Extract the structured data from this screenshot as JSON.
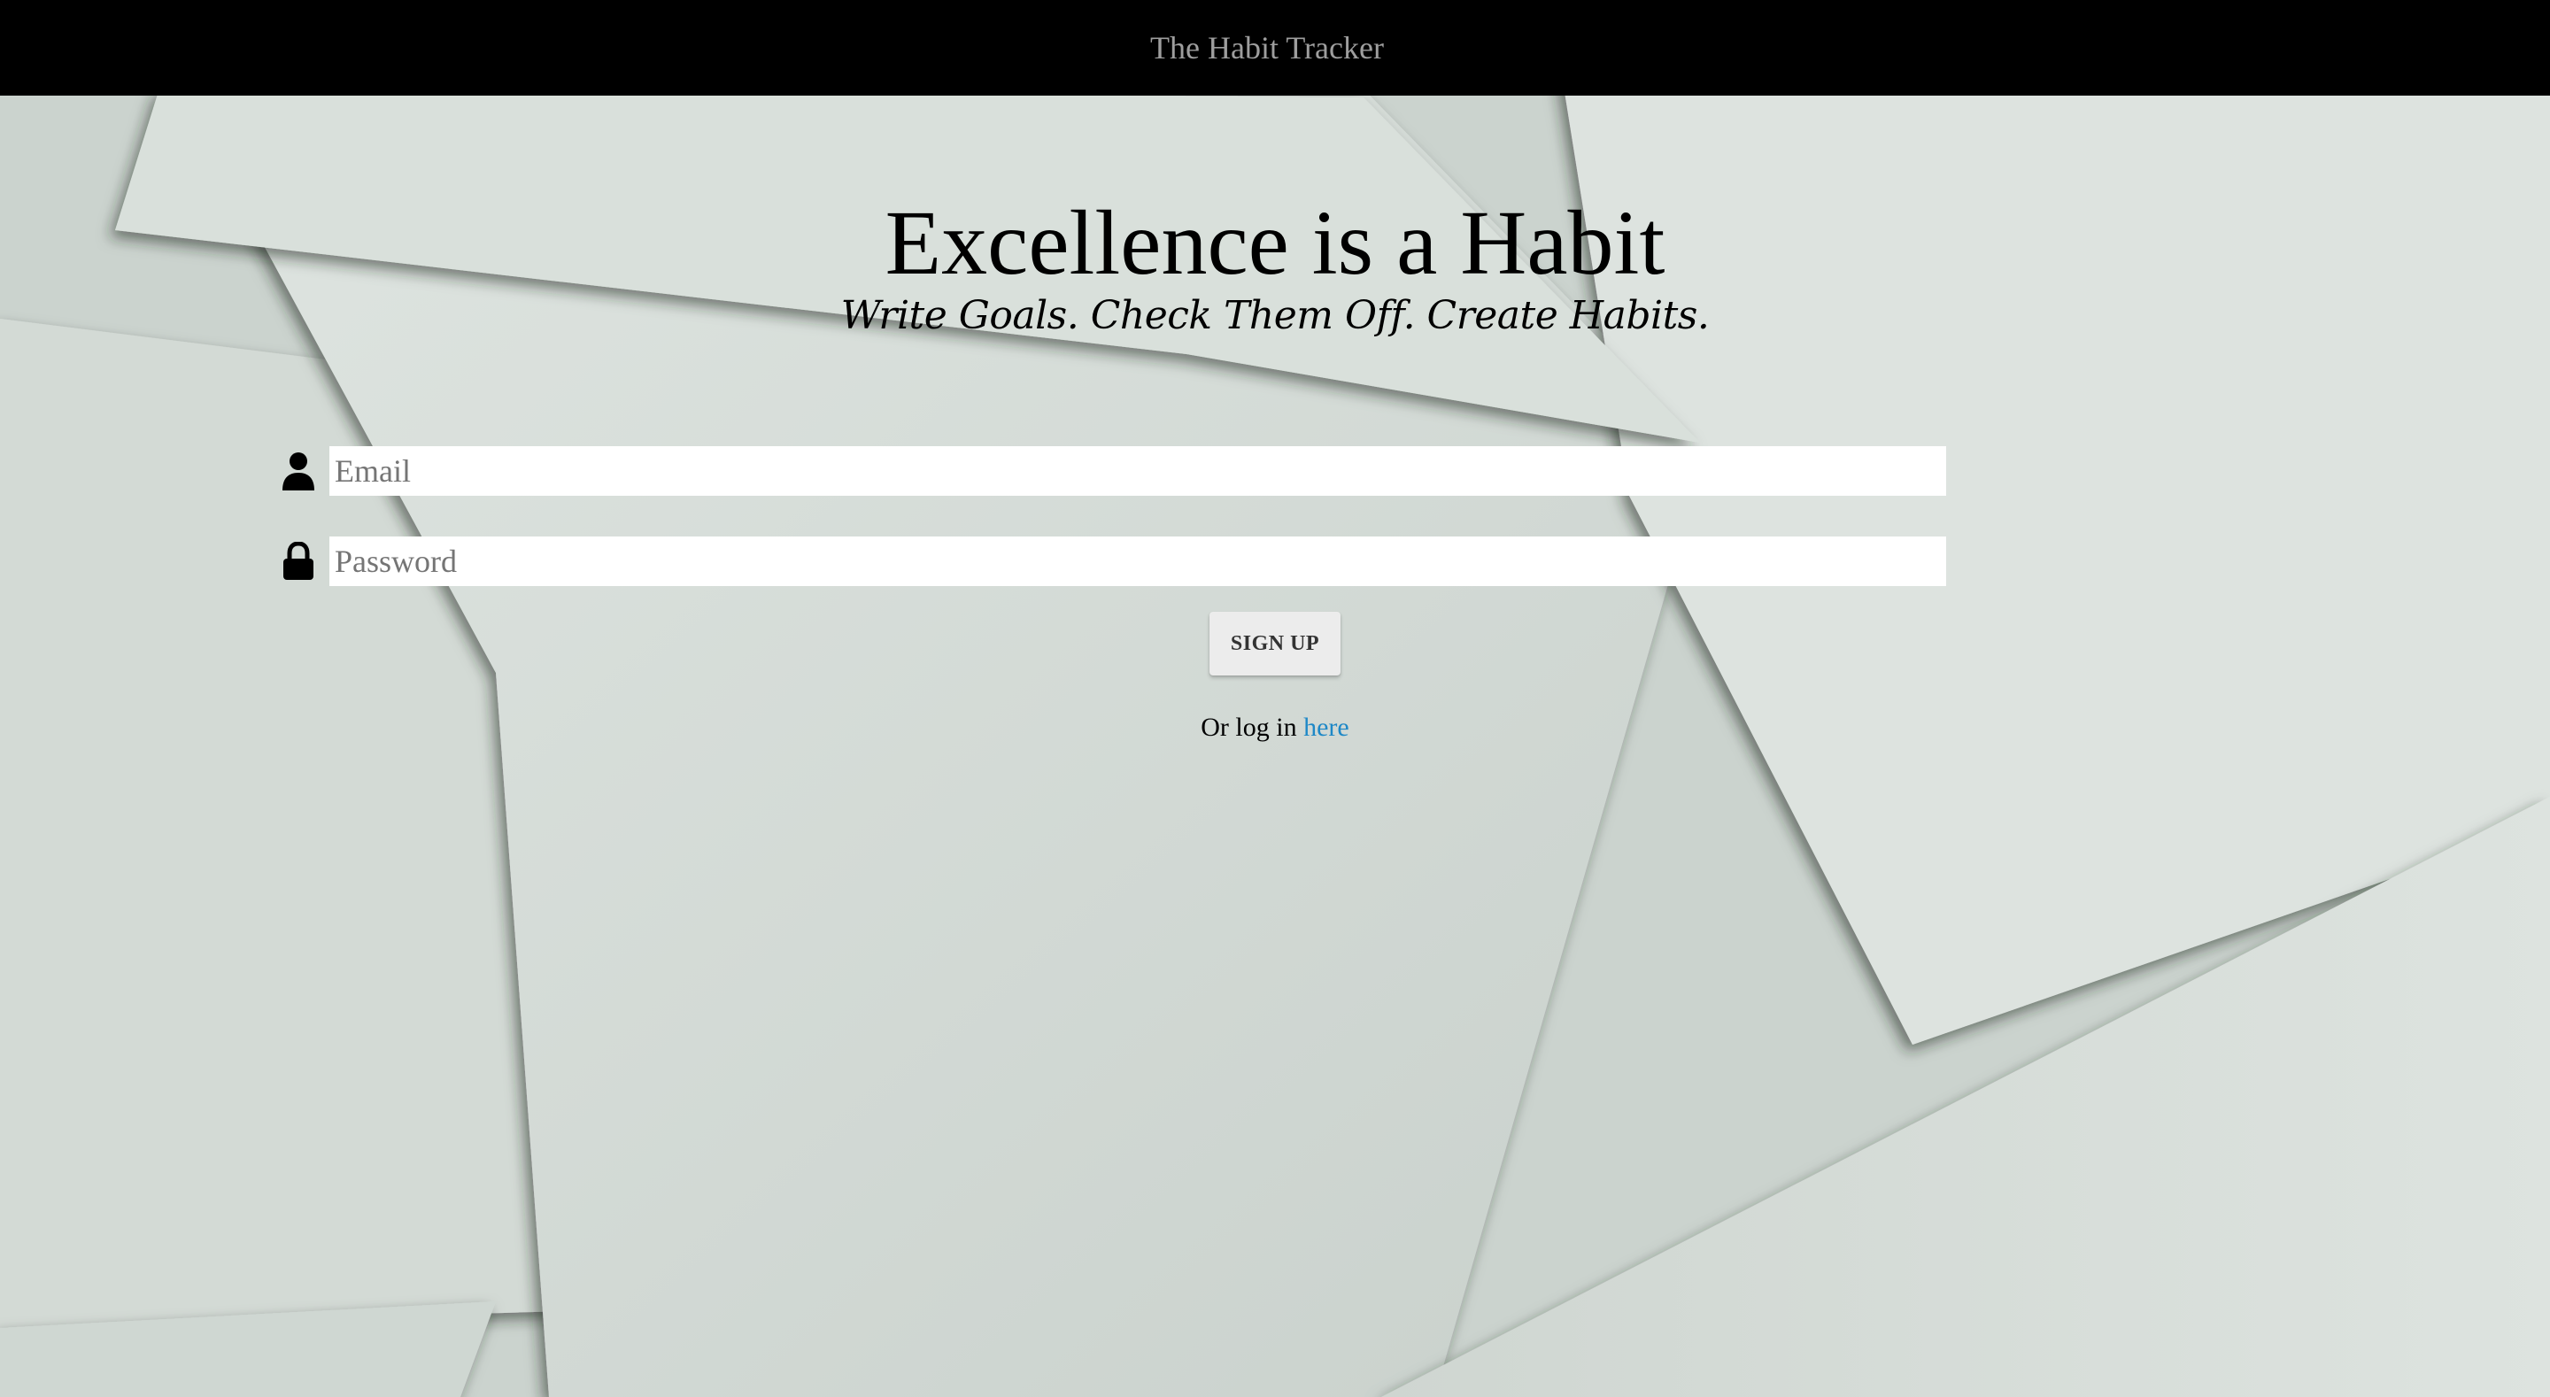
{
  "navbar": {
    "brand": "The Habit Tracker"
  },
  "hero": {
    "title": "Excellence is a Habit",
    "subtitle": "Write Goals. Check Them Off. Create Habits."
  },
  "form": {
    "email": {
      "placeholder": "Email",
      "value": "",
      "icon": "person-icon"
    },
    "password": {
      "placeholder": "Password",
      "value": "",
      "icon": "lock-icon"
    },
    "submit_label": "SIGN UP"
  },
  "alt_link": {
    "prefix": "Or log in ",
    "link_text": "here"
  },
  "colors": {
    "navbar_bg": "#000000",
    "brand_text": "#9e9e9e",
    "link": "#1e88c7",
    "background_paper": "#d6ddd8"
  }
}
